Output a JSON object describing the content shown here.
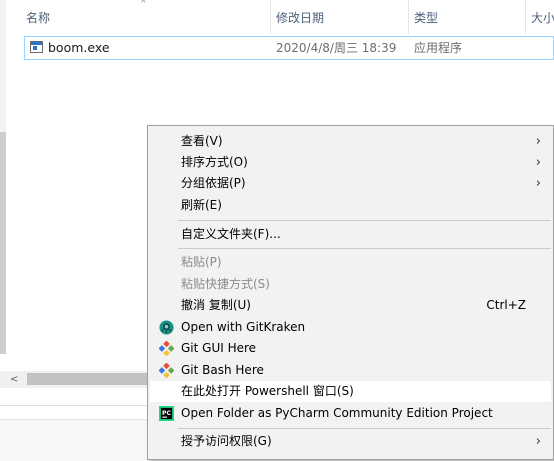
{
  "header": {
    "name_label": "名称",
    "date_label": "修改日期",
    "type_label": "类型",
    "size_label": "大小",
    "sort_arrow": "˄"
  },
  "file": {
    "name": "boom.exe",
    "date": "2020/4/8/周三 18:39",
    "type": "应用程序",
    "icon": "exe-file-icon"
  },
  "scrollbar": {
    "left_arrow": "<",
    "right_arrow": ">"
  },
  "menu": {
    "items": [
      {
        "label": "查看(V)",
        "submenu": true
      },
      {
        "label": "排序方式(O)",
        "submenu": true
      },
      {
        "label": "分组依据(P)",
        "submenu": true
      },
      {
        "label": "刷新(E)"
      },
      {
        "label": "自定义文件夹(F)..."
      },
      {
        "label": "粘贴(P)",
        "disabled": true
      },
      {
        "label": "粘贴快捷方式(S)",
        "disabled": true
      },
      {
        "label": "撤消 复制(U)",
        "shortcut": "Ctrl+Z"
      },
      {
        "label": "Open with GitKraken",
        "icon": "gitkraken-icon"
      },
      {
        "label": "Git GUI Here",
        "icon": "git-icon"
      },
      {
        "label": "Git Bash Here",
        "icon": "git-icon"
      },
      {
        "label": "在此处打开 Powershell 窗口(S)",
        "highlighted": true
      },
      {
        "label": "Open Folder as PyCharm Community Edition Project",
        "icon": "pycharm-icon"
      },
      {
        "label": "授予访问权限(G)",
        "submenu": true
      }
    ],
    "submenu_glyph": "›"
  },
  "colors": {
    "header_text": "#4c607a",
    "selection_border": "#99d1ff",
    "menu_bg": "#f2f2f2",
    "menu_highlight": "#ffffff",
    "gitkraken": "#179287",
    "git_red": "#e94e31",
    "pycharm": "#000000"
  }
}
